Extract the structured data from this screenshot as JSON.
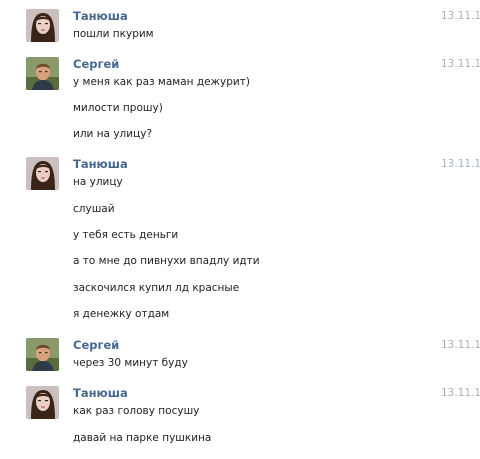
{
  "messages": [
    {
      "author": "Танюша",
      "date": "13.11.1",
      "avatar": "girl-avatar",
      "lines": [
        "пошли пкурим"
      ]
    },
    {
      "author": "Сергей",
      "date": "13.11.1",
      "avatar": "boy-avatar",
      "lines": [
        "у меня как раз маман дежурит)",
        "милости прошу)",
        "или на улицу?"
      ]
    },
    {
      "author": "Танюша",
      "date": "13.11.1",
      "avatar": "girl-avatar",
      "lines": [
        "на улицу",
        "слушай",
        "у тебя есть деньги",
        "а то мне до пивнухи впадлу идти",
        "заскочился купил лд красные",
        "я денежку отдам"
      ]
    },
    {
      "author": "Сергей",
      "date": "13.11.1",
      "avatar": "boy-avatar",
      "lines": [
        "через 30 минут буду"
      ]
    },
    {
      "author": "Танюша",
      "date": "13.11.1",
      "avatar": "girl-avatar",
      "lines": [
        "как раз голову посушу",
        "давай на парке пушкина"
      ]
    }
  ]
}
